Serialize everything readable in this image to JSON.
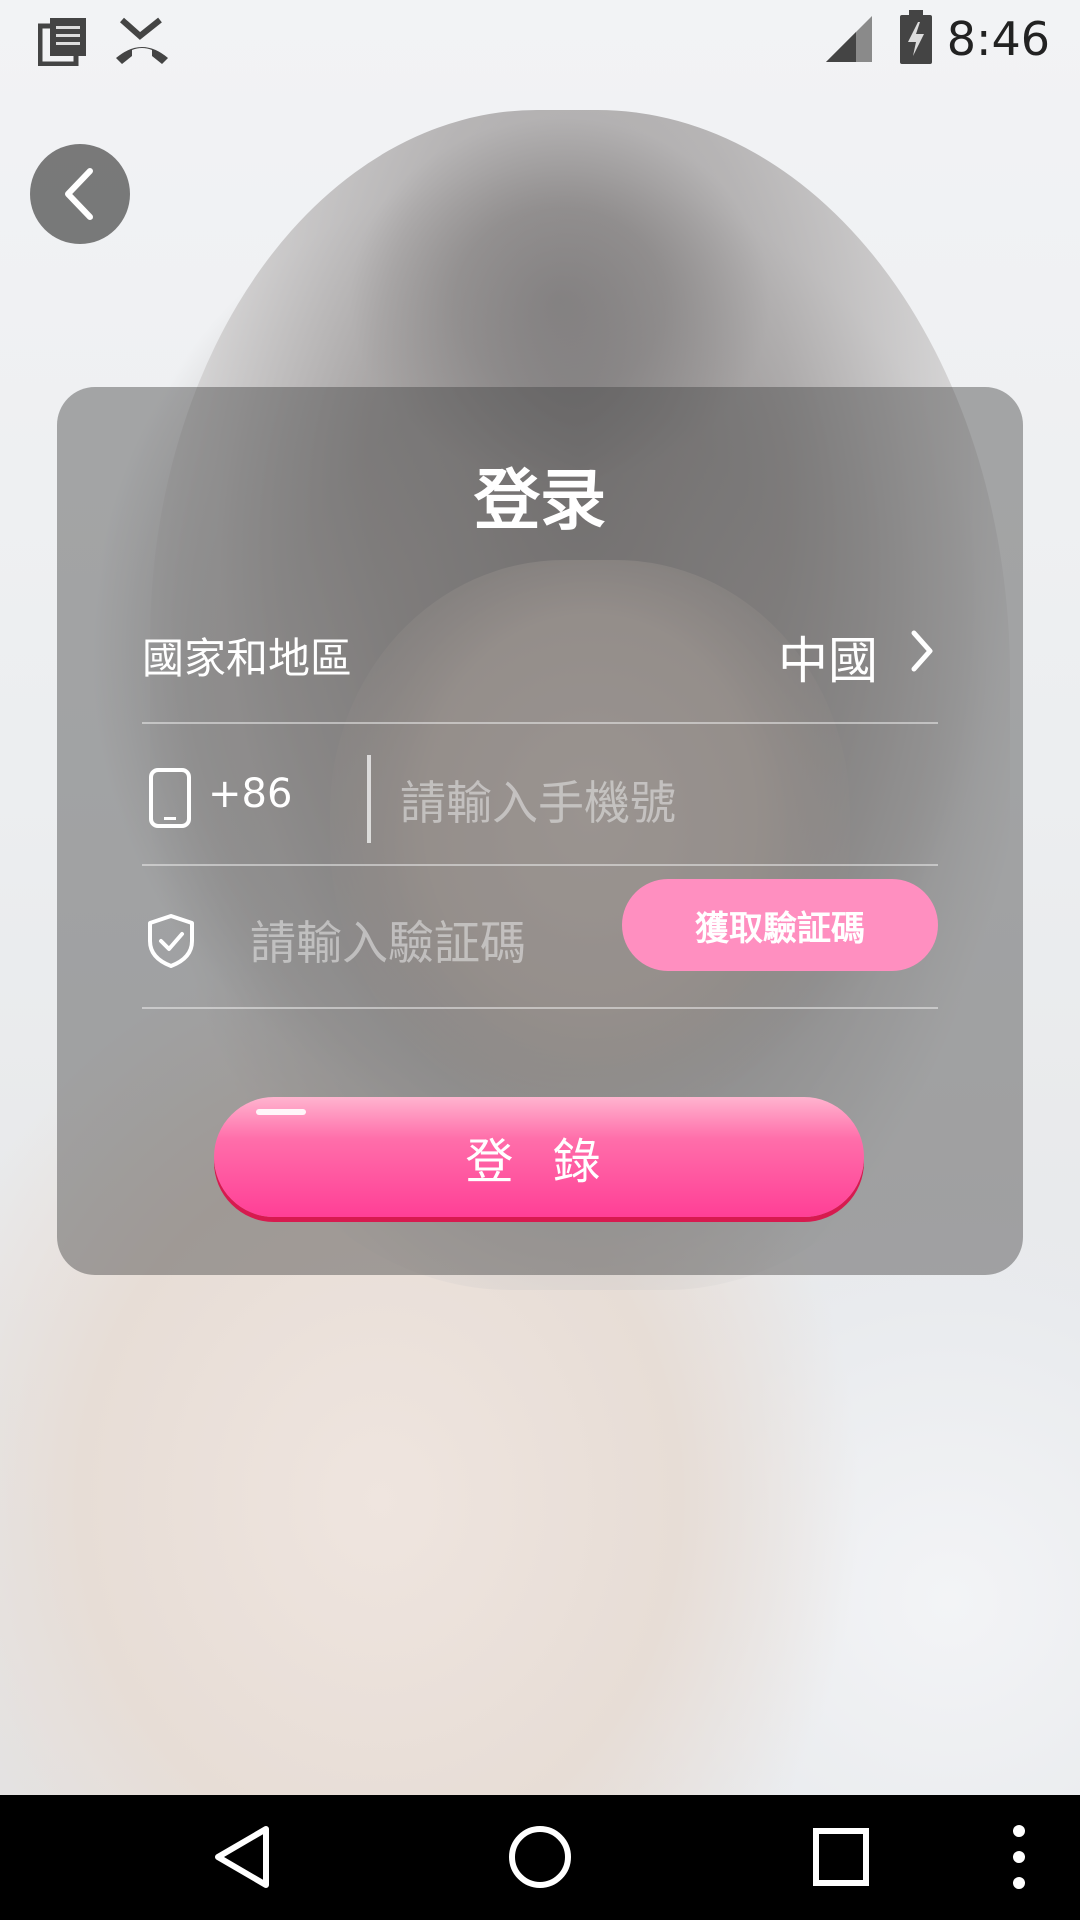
{
  "status_bar": {
    "time": "8:46",
    "icons": [
      "notes-icon",
      "missed-call-icon",
      "signal-icon",
      "battery-charging-icon"
    ]
  },
  "login_card": {
    "title": "登录",
    "region": {
      "label": "國家和地區",
      "value": "中國"
    },
    "phone": {
      "country_code": "+86",
      "placeholder": "請輸入手機號",
      "value": ""
    },
    "verification": {
      "placeholder": "請輸入驗証碼",
      "value": "",
      "get_code_label": "獲取驗証碼"
    },
    "submit_label": "登 錄"
  },
  "colors": {
    "accent_pink": "#ff8fc0",
    "button_pink": "#ff3f96"
  },
  "nav_bar": {
    "icons": [
      "back-icon",
      "home-icon",
      "recents-icon",
      "more-icon"
    ]
  }
}
